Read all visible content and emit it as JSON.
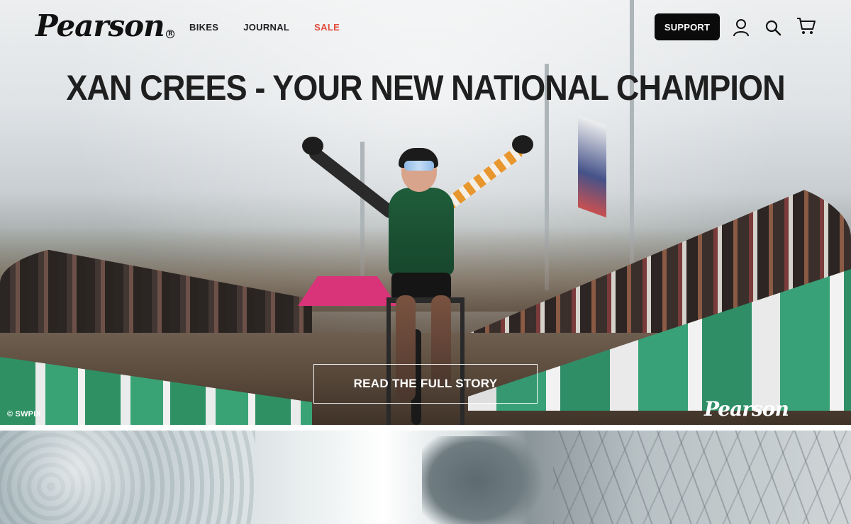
{
  "header": {
    "logo_text": "Pearson",
    "logo_mark": "R",
    "nav": [
      {
        "label": "BIKES"
      },
      {
        "label": "JOURNAL"
      },
      {
        "label": "SALE"
      }
    ],
    "support_label": "SUPPORT",
    "icons": [
      "account-icon",
      "search-icon",
      "cart-icon"
    ],
    "sale_color": "#e14b3b"
  },
  "hero": {
    "headline": "XAN CREES - YOUR NEW NATIONAL CHAMPION",
    "cta_label": "READ THE FULL STORY",
    "photo_credit": "© SWPIX",
    "watermark": "Pearson"
  }
}
